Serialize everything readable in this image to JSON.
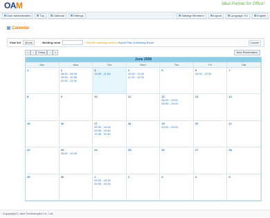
{
  "brand": {
    "logo_main": "OA",
    "logo_accent": "M",
    "tagline_left": "Ideal Partner ",
    "tagline_right": "for Office!"
  },
  "toolbar": {
    "left": [
      {
        "name": "user-admin-button",
        "label": "User administration"
      },
      {
        "name": "top-button",
        "label": "Top"
      },
      {
        "name": "calendar-button",
        "label": "Calendar"
      },
      {
        "name": "settings-button",
        "label": "Settings"
      }
    ],
    "right": [
      {
        "name": "manage-members-button",
        "label": "Manage Members"
      },
      {
        "name": "logout-button",
        "label": "Logout"
      },
      {
        "name": "language-select",
        "label": "Language: En"
      },
      {
        "name": "english-button",
        "label": "English"
      }
    ]
  },
  "page": {
    "title": "Calendar"
  },
  "controls": {
    "view_label": "View list",
    "view_value": "Month",
    "meeting_label": "Meeting room",
    "legend_prefix": "Click the meeting name to ",
    "legend_link": "Export Plan & Meeting Room",
    "cancel": "Cancel"
  },
  "nav": {
    "prev_year": "«",
    "prev": "‹",
    "today": "Today",
    "next": "›",
    "next_year": "»",
    "new_event": "New Reservation"
  },
  "calendar": {
    "month_title": "June 2008",
    "days_of_week": [
      "Sun",
      "Mon",
      "Tue",
      "Wed",
      "Thu",
      "Fri",
      "Sat"
    ],
    "cells": [
      {
        "day": "1",
        "events": []
      },
      {
        "day": "2",
        "events": [
          "08:30 - 09:30",
          "09:30 - 10:30",
          "10:30 - 11:30"
        ]
      },
      {
        "day": "3",
        "events": [
          "10:00 - 11:00"
        ],
        "today": true
      },
      {
        "day": "4",
        "events": [
          "10:00 - 11:00",
          "11:00 - 12:00"
        ]
      },
      {
        "day": "5",
        "events": []
      },
      {
        "day": "6",
        "events": [
          "09:30 - 10:30"
        ]
      },
      {
        "day": "7",
        "events": []
      },
      {
        "day": "8",
        "events": []
      },
      {
        "day": "9",
        "events": []
      },
      {
        "day": "10",
        "events": []
      },
      {
        "day": "11",
        "events": []
      },
      {
        "day": "12",
        "events": [
          "09:00 - 10:00",
          "09:00 - 10:00"
        ]
      },
      {
        "day": "13",
        "events": []
      },
      {
        "day": "14",
        "events": []
      },
      {
        "day": "15",
        "events": []
      },
      {
        "day": "16",
        "events": []
      },
      {
        "day": "17",
        "events": [
          "09:30 - 10:30",
          "09:30 - 10:30",
          "10:30 - 11:30"
        ]
      },
      {
        "day": "18",
        "events": []
      },
      {
        "day": "19",
        "events": [
          "09:00 - 10:00"
        ]
      },
      {
        "day": "20",
        "events": []
      },
      {
        "day": "21",
        "events": []
      },
      {
        "day": "22",
        "events": []
      },
      {
        "day": "23",
        "events": [
          "09:30 - 10:30"
        ]
      },
      {
        "day": "24",
        "events": []
      },
      {
        "day": "25",
        "events": []
      },
      {
        "day": "26",
        "events": []
      },
      {
        "day": "27",
        "events": []
      },
      {
        "day": "28",
        "events": []
      },
      {
        "day": "29",
        "events": []
      },
      {
        "day": "30",
        "events": []
      },
      {
        "day": "1",
        "events": [
          "09:30 - 10:30",
          "09:30 - 10:30"
        ]
      },
      {
        "day": "2",
        "events": []
      },
      {
        "day": "3",
        "events": []
      },
      {
        "day": "4",
        "events": []
      },
      {
        "day": "5",
        "events": []
      }
    ]
  },
  "footer": {
    "copyright": "Copyright(C) Jane Technologies Co., Ltd."
  }
}
